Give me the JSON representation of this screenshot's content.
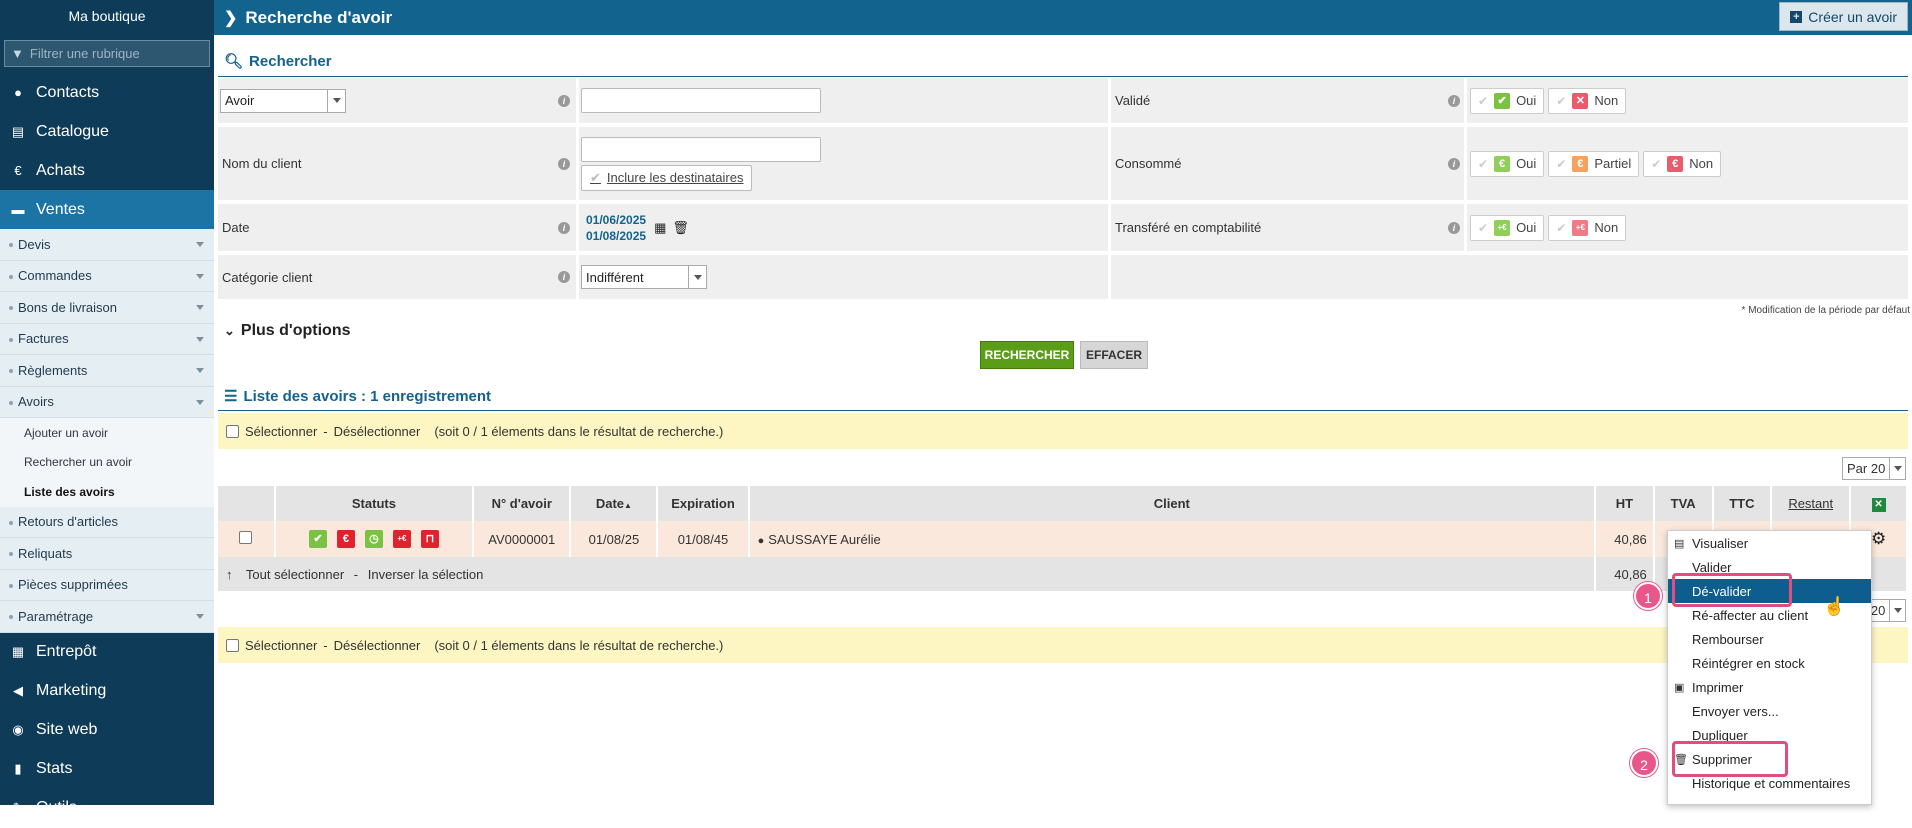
{
  "sidebar": {
    "shop_name": "Ma boutique",
    "filter_placeholder": "Filtrer une rubrique",
    "main_items": [
      {
        "label": "Contacts",
        "icon": "user-icon"
      },
      {
        "label": "Catalogue",
        "icon": "book-icon"
      },
      {
        "label": "Achats",
        "icon": "euro-icon"
      },
      {
        "label": "Ventes",
        "icon": "cart-icon"
      }
    ],
    "sub_items": [
      "Devis",
      "Commandes",
      "Bons de livraison",
      "Factures",
      "Règlements",
      "Avoirs"
    ],
    "avoirs_items": [
      "Ajouter un avoir",
      "Rechercher un avoir",
      "Liste des avoirs"
    ],
    "sub_items2": [
      "Retours d'articles",
      "Reliquats",
      "Pièces supprimées",
      "Paramétrage"
    ],
    "bottom_items": [
      {
        "label": "Entrepôt",
        "icon": "warehouse-icon"
      },
      {
        "label": "Marketing",
        "icon": "megaphone-icon"
      },
      {
        "label": "Site web",
        "icon": "globe-icon"
      },
      {
        "label": "Stats",
        "icon": "chart-icon"
      },
      {
        "label": "Outils",
        "icon": "tools-icon"
      }
    ]
  },
  "header": {
    "title": "Recherche d'avoir",
    "create_label": "Créer un avoir"
  },
  "search": {
    "title": "Rechercher",
    "type_select": "Avoir",
    "client_label": "Nom du client",
    "include_label": "Inclure les destinataires",
    "date_label": "Date",
    "date_start": "01/06/2025",
    "date_end": "01/08/2025",
    "category_label": "Catégorie client",
    "category_value": "Indifférent",
    "valide_label": "Validé",
    "consomme_label": "Consommé",
    "transfere_label": "Transféré en comptabilité",
    "oui": "Oui",
    "non": "Non",
    "partiel": "Partiel",
    "note": "* Modification de la période par défaut",
    "more_options": "Plus d'options",
    "search_btn": "RECHERCHER",
    "clear_btn": "EFFACER"
  },
  "list": {
    "title": "Liste des avoirs : 1 enregistrement",
    "select": "Sélectionner",
    "sep": "-",
    "deselect": "Désélectionner",
    "selection_info": "(soit 0 / 1 élements dans le résultat de recherche.)",
    "per_page": "Par 20",
    "columns": {
      "statuts": "Statuts",
      "num": "N° d'avoir",
      "date": "Date",
      "expiration": "Expiration",
      "client": "Client",
      "ht": "HT",
      "tva": "TVA",
      "ttc": "TTC",
      "restant": "Restant"
    },
    "row": {
      "num": "AV0000001",
      "date": "01/08/25",
      "expiration": "01/08/45",
      "client": "SAUSSAYE Aurélie",
      "ht": "40,86"
    },
    "footer": {
      "select_all": "Tout sélectionner",
      "sep": "-",
      "invert": "Inverser la sélection",
      "ht_total": "40,86"
    }
  },
  "context_menu": {
    "items": [
      "Visualiser",
      "Valider",
      "Dé-valider",
      "Ré-affecter au client",
      "Rembourser",
      "Réintégrer en stock",
      "Imprimer",
      "Envoyer vers...",
      "Dupliquer",
      "Supprimer",
      "Historique et commentaires"
    ],
    "badge1": "1",
    "badge2": "2"
  },
  "colors": {
    "sidebar": "#0e3c58",
    "header": "#13638f",
    "active": "#1b74a4",
    "green": "#5b9d18",
    "highlight": "#0d5e8e",
    "annotation": "#e24d7d"
  }
}
